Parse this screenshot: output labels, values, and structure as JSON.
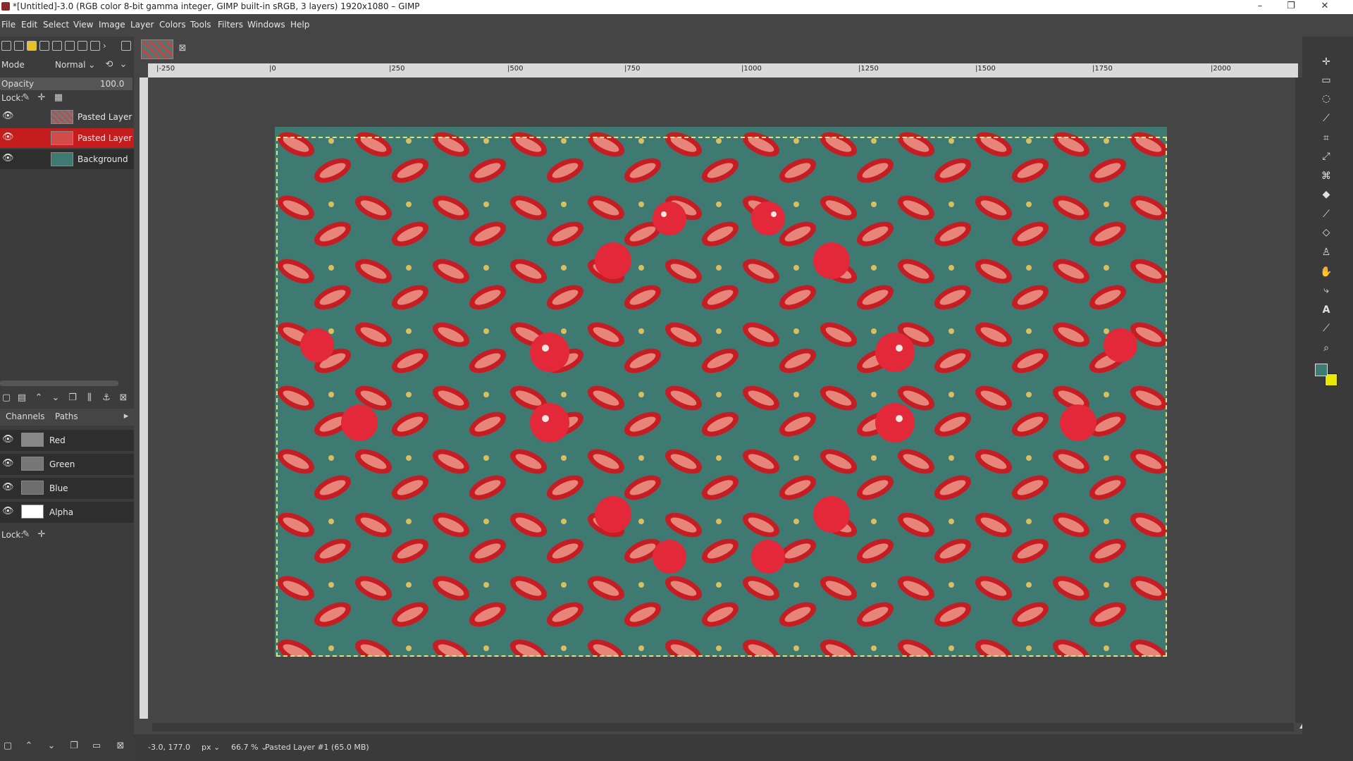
{
  "window": {
    "title": "*[Untitled]-3.0 (RGB color 8-bit gamma integer, GIMP built-in sRGB, 3 layers) 1920x1080 – GIMP",
    "minimize": "–",
    "maximize": "❐",
    "close": "✕"
  },
  "menubar": {
    "items": [
      "File",
      "Edit",
      "Select",
      "View",
      "Image",
      "Layer",
      "Colors",
      "Tools",
      "Filters",
      "Windows",
      "Help"
    ]
  },
  "layers_panel": {
    "mode_label": "Mode",
    "mode_value": "Normal",
    "opacity_label": "Opacity",
    "opacity_value": "100.0",
    "lock_label": "Lock:",
    "layers": [
      {
        "name": "Pasted Layer",
        "active": false
      },
      {
        "name": "Pasted Layer",
        "active": true
      },
      {
        "name": "Background",
        "active": false
      }
    ]
  },
  "channels_panel": {
    "tab_channels": "Channels",
    "tab_paths": "Paths",
    "channels": [
      "Red",
      "Green",
      "Blue",
      "Alpha"
    ],
    "lock_label": "Lock:"
  },
  "rulers": {
    "h_ticks": [
      "|-250",
      "|0",
      "|250",
      "|500",
      "|750",
      "|1000",
      "|1250",
      "|1500",
      "|1750",
      "|2000"
    ]
  },
  "statusbar": {
    "coords": "-3.0, 177.0",
    "unit": "px",
    "zoom": "66.7 %",
    "info": "Pasted Layer #1 (65.0 MB)"
  },
  "colors": {
    "fg": "#3f7a72",
    "bg": "#e8e800",
    "active_layer": "#c51d1d",
    "canvas_teal": "#3f7a72"
  }
}
